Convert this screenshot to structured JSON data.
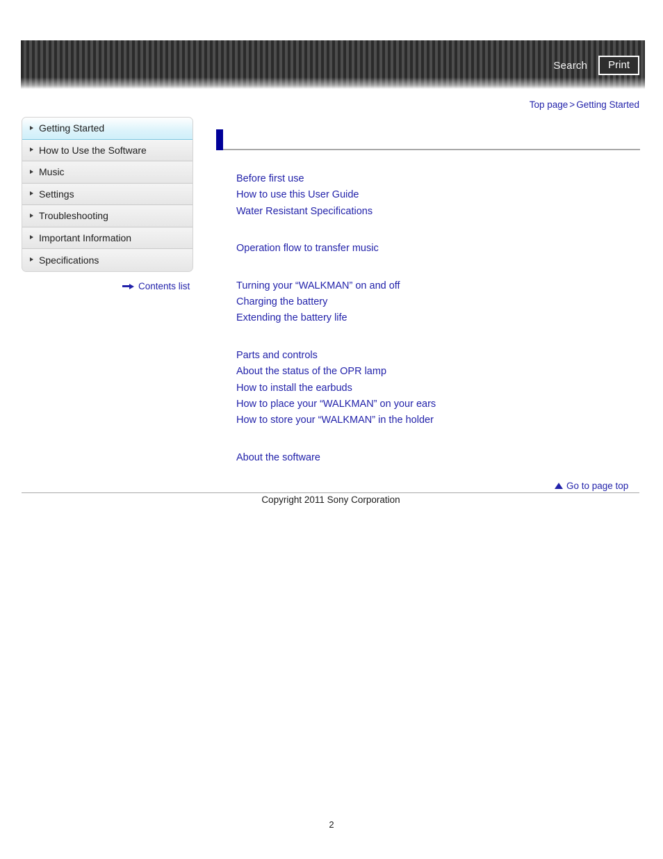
{
  "header": {
    "search_label": "Search",
    "print_label": "Print"
  },
  "breadcrumb": {
    "top_page": "Top page",
    "separator": ">",
    "current": "Getting Started"
  },
  "sidebar": {
    "items": [
      {
        "label": "Getting Started",
        "active": true
      },
      {
        "label": "How to Use the Software",
        "active": false
      },
      {
        "label": "Music",
        "active": false
      },
      {
        "label": "Settings",
        "active": false
      },
      {
        "label": "Troubleshooting",
        "active": false
      },
      {
        "label": "Important Information",
        "active": false
      },
      {
        "label": "Specifications",
        "active": false
      }
    ],
    "contents_list_label": "Contents list"
  },
  "main": {
    "page_title": "",
    "groups": [
      {
        "links": [
          "Before first use",
          "How to use this User Guide",
          "Water Resistant Specifications"
        ]
      },
      {
        "links": [
          "Operation flow to transfer music"
        ]
      },
      {
        "links": [
          "Turning your “WALKMAN” on and off",
          "Charging the battery",
          "Extending the battery life"
        ]
      },
      {
        "links": [
          "Parts and controls",
          "About the status of the OPR lamp",
          "How to install the earbuds",
          "How to place your “WALKMAN” on your ears",
          "How to store your “WALKMAN” in the holder"
        ]
      },
      {
        "links": [
          "About the software"
        ]
      }
    ]
  },
  "footer": {
    "go_top_label": "Go to page top",
    "copyright": "Copyright 2011 Sony Corporation",
    "page_number": "2"
  },
  "colors": {
    "link_blue": "#2222aa",
    "title_marker": "#000099",
    "active_nav": "#cfeffa",
    "header_dark": "#2b2b2b",
    "header_light": "#4d4d4d"
  }
}
